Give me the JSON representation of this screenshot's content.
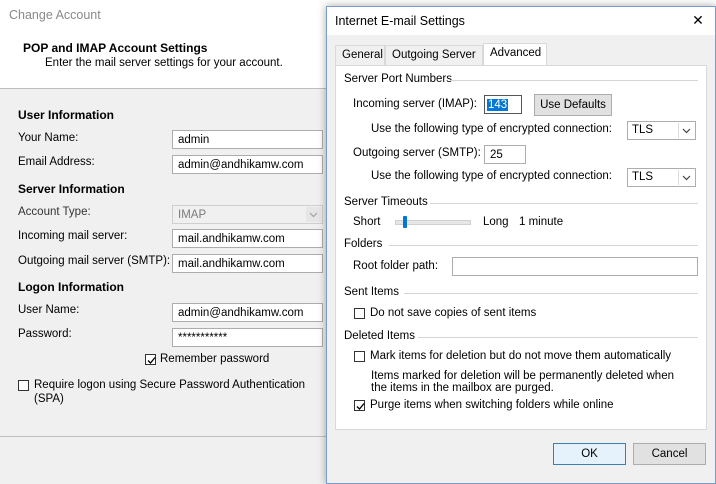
{
  "background_window": {
    "title": "Change Account",
    "header_title": "POP and IMAP Account Settings",
    "header_subtitle": "Enter the mail server settings for your account.",
    "user_info_heading": "User Information",
    "your_name_label": "Your Name:",
    "your_name_value": "admin",
    "email_label": "Email Address:",
    "email_value": "admin@andhikamw.com",
    "server_info_heading": "Server Information",
    "account_type_label": "Account Type:",
    "account_type_value": "IMAP",
    "incoming_label": "Incoming mail server:",
    "incoming_value": "mail.andhikamw.com",
    "outgoing_label": "Outgoing mail server (SMTP):",
    "outgoing_value": "mail.andhikamw.com",
    "logon_heading": "Logon Information",
    "username_label": "User Name:",
    "username_value": "admin@andhikamw.com",
    "password_label": "Password:",
    "password_value": "***********",
    "remember_label": "Remember password",
    "remember_checked": true,
    "spa_label_line1": "Require logon using Secure Password Authentication",
    "spa_label_line2": "(SPA)",
    "spa_checked": false
  },
  "dialog": {
    "title": "Internet E-mail Settings",
    "close_glyph": "✕",
    "tabs": [
      {
        "label": "General",
        "active": false
      },
      {
        "label": "Outgoing Server",
        "active": false
      },
      {
        "label": "Advanced",
        "active": true
      }
    ],
    "server_ports": {
      "heading": "Server Port Numbers",
      "incoming_label": "Incoming server (IMAP):",
      "incoming_value": "143",
      "use_defaults_label": "Use Defaults",
      "enc_label": "Use the following type of encrypted connection:",
      "incoming_enc": "TLS",
      "outgoing_label": "Outgoing server (SMTP):",
      "outgoing_value": "25",
      "outgoing_enc": "TLS"
    },
    "timeouts": {
      "heading": "Server Timeouts",
      "short_label": "Short",
      "long_label": "Long",
      "value": "1 minute",
      "slider_fraction": 0.1
    },
    "folders": {
      "heading": "Folders",
      "root_label": "Root folder path:",
      "root_value": ""
    },
    "sent_items": {
      "heading": "Sent Items",
      "no_save_label": "Do not save copies of sent items",
      "no_save_checked": false
    },
    "deleted_items": {
      "heading": "Deleted Items",
      "mark_label": "Mark items for deletion but do not move them automatically",
      "mark_checked": false,
      "info_line1": "Items marked for deletion will be permanently deleted when",
      "info_line2": "the items in the mailbox are purged.",
      "purge_label": "Purge items when switching folders while online",
      "purge_checked": true
    },
    "ok_label": "OK",
    "cancel_label": "Cancel"
  }
}
